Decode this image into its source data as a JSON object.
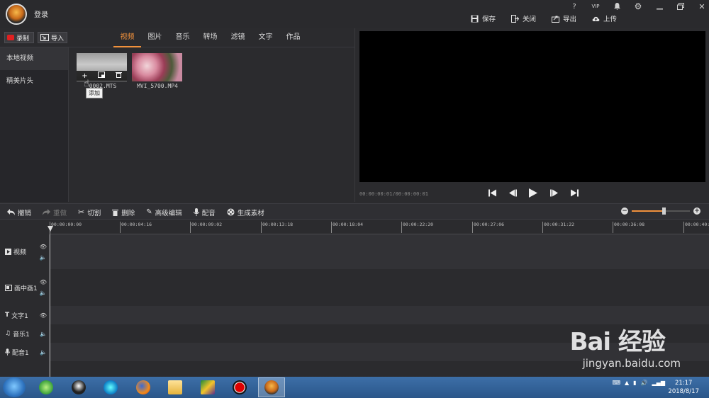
{
  "app": {
    "login_label": "登录",
    "window_controls": [
      "?",
      "VIP",
      "🔔",
      "⚙",
      "🗕",
      "❐",
      "✕"
    ],
    "actions": [
      {
        "label": "保存",
        "icon": "save-icon"
      },
      {
        "label": "关闭",
        "icon": "close-file-icon"
      },
      {
        "label": "导出",
        "icon": "export-icon"
      },
      {
        "label": "上传",
        "icon": "upload-icon"
      }
    ]
  },
  "library": {
    "record_label": "录制",
    "import_label": "导入",
    "tabs": [
      "视频",
      "图片",
      "音乐",
      "转场",
      "滤镜",
      "文字",
      "作品"
    ],
    "active_tab": "视频",
    "sidebar": [
      "本地视频",
      "精美片头"
    ],
    "items": [
      {
        "name": "00002.MTS",
        "shown_name": "0002.MTS"
      },
      {
        "name": "MVI_5700.MP4",
        "shown_name": "MVI_5700.MP4"
      }
    ],
    "tooltip": "添加"
  },
  "preview": {
    "timecode": "00:00:00:01/00:00:00:01"
  },
  "edit_toolbar": {
    "tools": [
      {
        "label": "撤销",
        "icon": "undo-icon",
        "enabled": true
      },
      {
        "label": "重做",
        "icon": "redo-icon",
        "enabled": false
      },
      {
        "label": "切割",
        "icon": "scissors-icon",
        "enabled": true
      },
      {
        "label": "删除",
        "icon": "trash-icon",
        "enabled": true
      },
      {
        "label": "高级编辑",
        "icon": "pencil-icon",
        "enabled": true
      },
      {
        "label": "配音",
        "icon": "mic-icon",
        "enabled": true
      },
      {
        "label": "生成素材",
        "icon": "film-reel-icon",
        "enabled": true
      }
    ],
    "zoom_level": 0.55
  },
  "timeline": {
    "ruler": [
      "00:00:00:00",
      "00:00:04:16",
      "00:00:09:02",
      "00:00:13:18",
      "00:00:18:04",
      "00:00:22:20",
      "00:00:27:06",
      "00:00:31:22",
      "00:00:36:08",
      "00:00:40:"
    ],
    "tracks": [
      {
        "label": "视频",
        "icon": "play-icon"
      },
      {
        "label": "画中画1",
        "icon": "pip-icon"
      },
      {
        "label": "文字1",
        "icon": "text-icon"
      },
      {
        "label": "音乐1",
        "icon": "music-icon"
      },
      {
        "label": "配音1",
        "icon": "mic-icon"
      }
    ]
  },
  "taskbar": {
    "time": "21:17",
    "date": "2018/8/17"
  },
  "watermark": {
    "main": "Bai 经验",
    "sub": "jingyan.baidu.com"
  }
}
